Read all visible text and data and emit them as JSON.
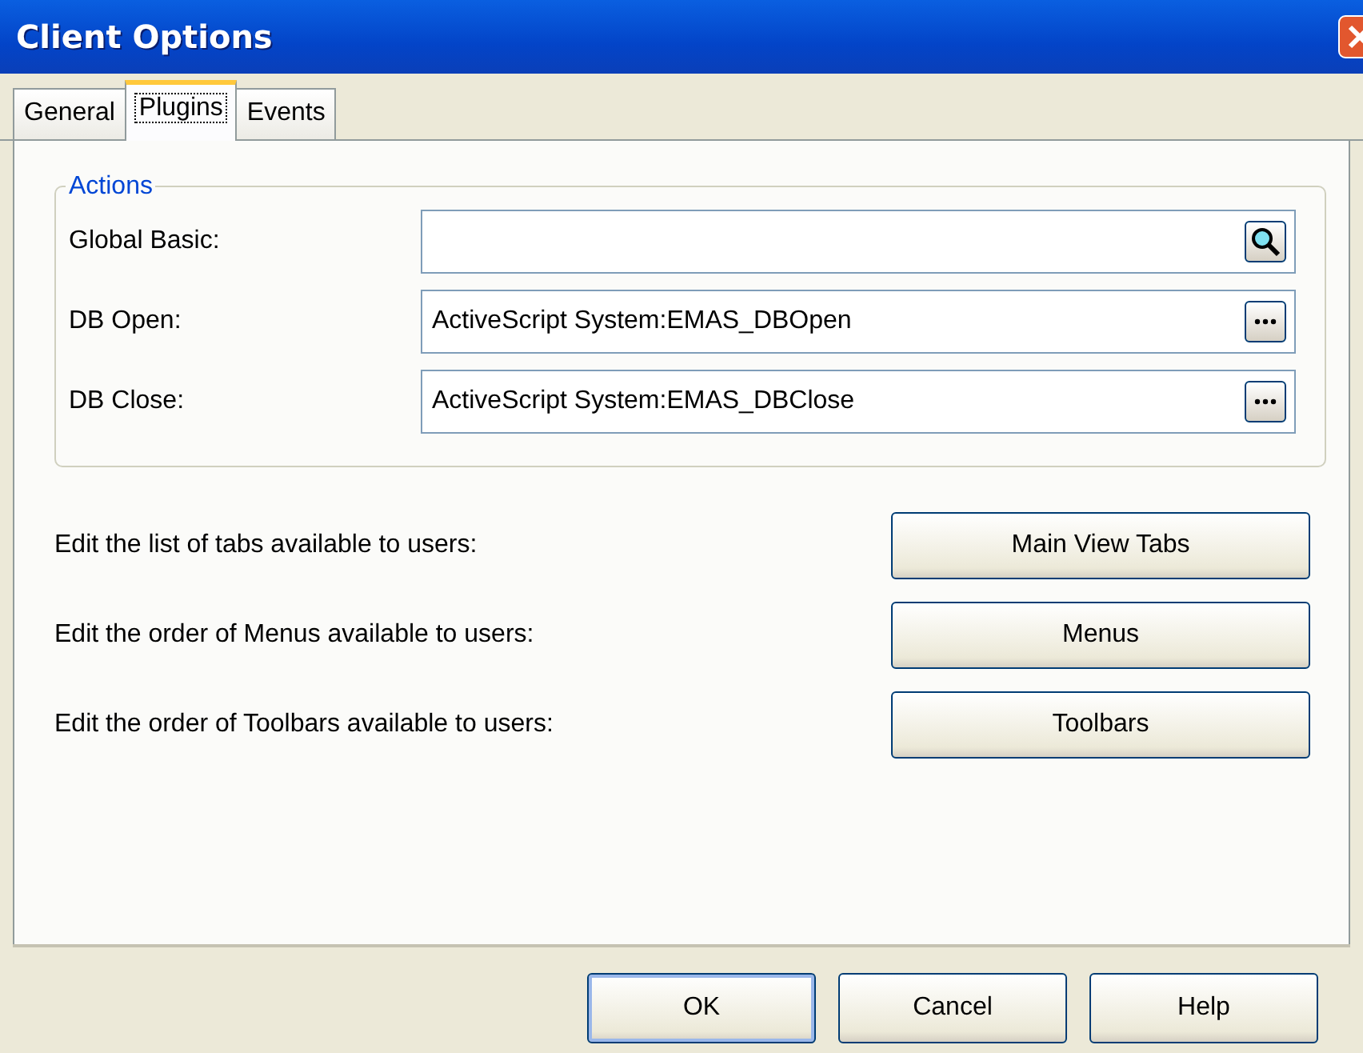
{
  "window": {
    "title": "Client Options"
  },
  "tabs": [
    {
      "label": "General",
      "selected": false
    },
    {
      "label": "Plugins",
      "selected": true
    },
    {
      "label": "Events",
      "selected": false
    }
  ],
  "actions": {
    "legend": "Actions",
    "fields": [
      {
        "label": "Global Basic:",
        "kind": "search"
      },
      {
        "label": "DB Open:",
        "value": "ActiveScript System:EMAS_DBOpen",
        "kind": "browse"
      },
      {
        "label": "DB Close:",
        "value": "ActiveScript System:EMAS_DBClose",
        "kind": "browse"
      }
    ]
  },
  "edit_rows": [
    {
      "text": "Edit the list of tabs available to users:",
      "button": "Main View Tabs"
    },
    {
      "text": "Edit the order of Menus available to users:",
      "button": "Menus"
    },
    {
      "text": "Edit the order of Toolbars available to users:",
      "button": "Toolbars"
    }
  ],
  "buttons": [
    {
      "label": "OK",
      "default": true
    },
    {
      "label": "Cancel",
      "default": false
    },
    {
      "label": "Help",
      "default": false
    }
  ]
}
